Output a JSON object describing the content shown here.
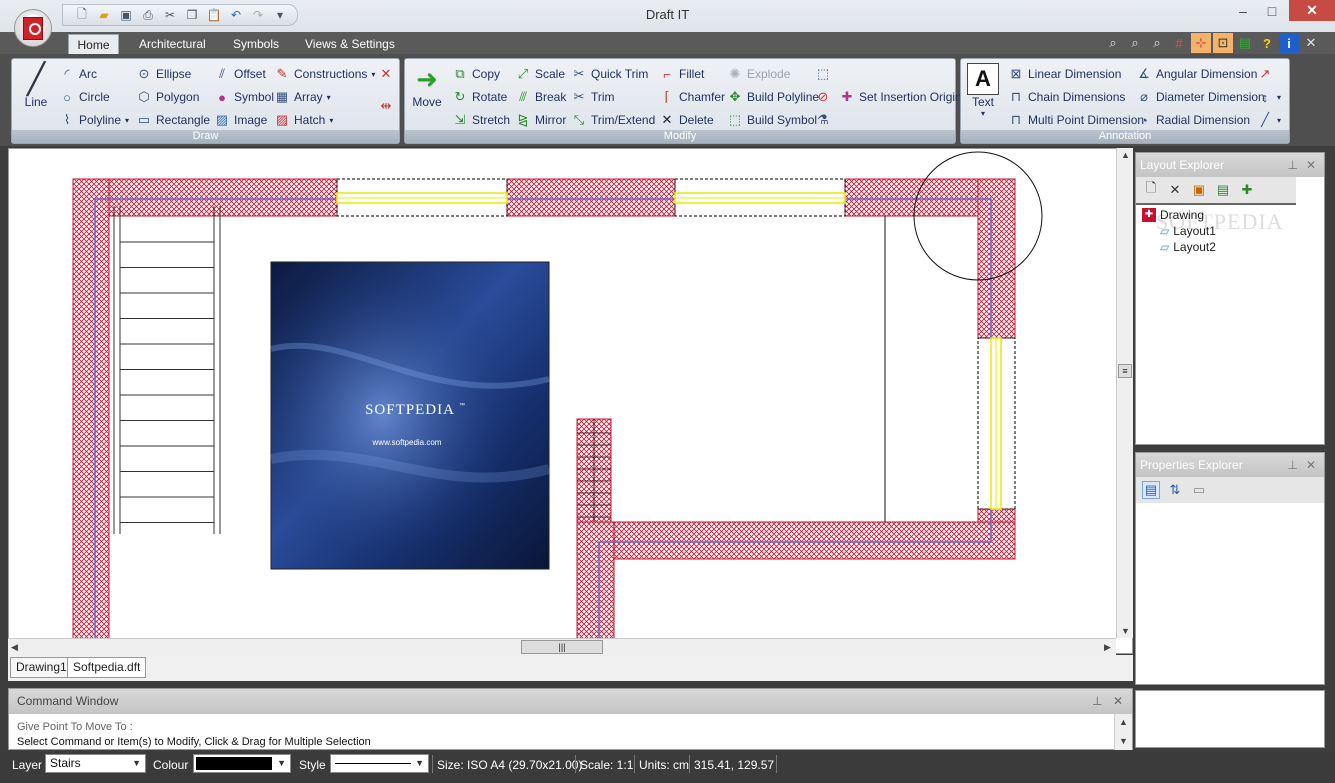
{
  "window": {
    "title": "Draft IT"
  },
  "quick_access": [
    "new-icon",
    "open-icon",
    "save-icon",
    "print-icon",
    "cut-icon",
    "copy-icon",
    "paste-icon",
    "undo-icon",
    "redo-icon",
    "customize-icon"
  ],
  "tabs": [
    "Home",
    "Architectural",
    "Symbols",
    "Views & Settings"
  ],
  "ribbon": {
    "draw": {
      "title": "Draw",
      "line": "Line",
      "items": [
        "Arc",
        "Circle",
        "Polyline",
        "Ellipse",
        "Polygon",
        "Rectangle",
        "Offset",
        "Symbol",
        "Image",
        "Constructions",
        "Array",
        "Hatch"
      ]
    },
    "modify": {
      "title": "Modify",
      "move": "Move",
      "items": [
        "Copy",
        "Rotate",
        "Stretch",
        "Scale",
        "Break",
        "Mirror",
        "Quick Trim",
        "Trim",
        "Trim/Extend",
        "Fillet",
        "Chamfer",
        "Delete",
        "Explode",
        "Build Polyline",
        "Build Symbol",
        "Set Insertion Origin"
      ]
    },
    "annotation": {
      "title": "Annotation",
      "text": "Text",
      "items": [
        "Linear Dimension",
        "Chain Dimensions",
        "Multi Point Dimension",
        "Angular Dimension",
        "Diameter Dimension",
        "Radial Dimension"
      ]
    }
  },
  "canvas_image": {
    "brand": "SOFTPEDIA",
    "tm": "™",
    "url": "www.softpedia.com"
  },
  "doc_tabs": [
    "Drawing1",
    "Softpedia.dft"
  ],
  "command_window": {
    "title": "Command Window",
    "line1": "Give Point To Move To :",
    "line2": "Select Command or Item(s) to Modify, Click & Drag for Multiple Selection"
  },
  "layout_explorer": {
    "title": "Layout Explorer",
    "root": "Drawing",
    "children": [
      "Layout1",
      "Layout2"
    ],
    "watermark": "SOFTPEDIA"
  },
  "properties_explorer": {
    "title": "Properties Explorer"
  },
  "status": {
    "layer_label": "Layer",
    "layer_value": "Stairs",
    "colour_label": "Colour",
    "style_label": "Style",
    "size": "Size: ISO A4 (29.70x21.00)",
    "scale": "Scale: 1:1",
    "units": "Units: cm",
    "coords": "315.41, 129.57"
  },
  "colors": {
    "wall_hatch": "#c8102e",
    "window": "#ffff00",
    "inner_line": "#6666cc"
  }
}
